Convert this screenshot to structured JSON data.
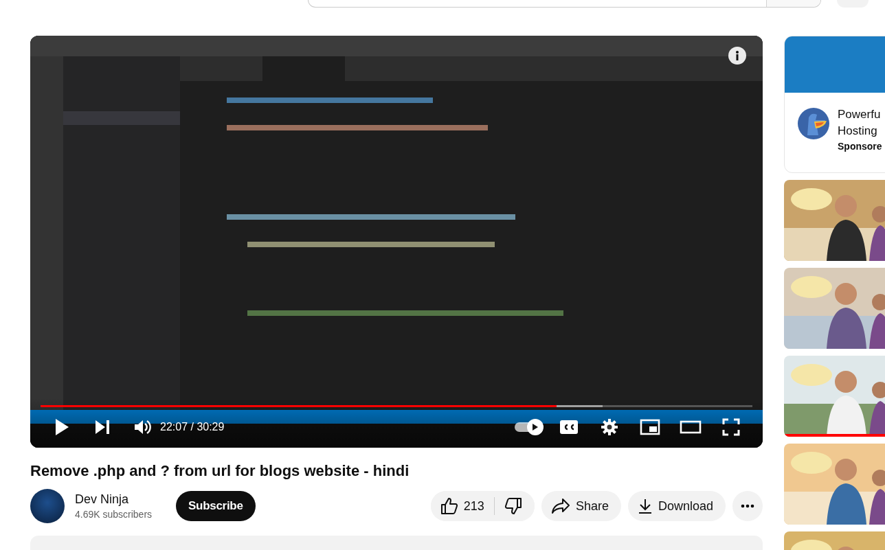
{
  "player": {
    "video": {
      "kind": "picture"
    },
    "progress": {
      "level": 0.725
    },
    "time": "22:07 / 30:29",
    "autoplay": {
      "on": true
    }
  },
  "video_title": "Remove .php and ? from url for blogs website - hindi",
  "channel": {
    "name": "Dev Ninja",
    "subscribers": "4.69K subscribers",
    "subscribe": "Subscribe"
  },
  "actions": {
    "likes": "213",
    "share": "Share",
    "download": "Download"
  },
  "sidebar": {
    "ad": {
      "title_lines": [
        "Powerfu",
        "Hosting"
      ],
      "label": "Sponsore"
    },
    "thumbnails": [
      {
        "kind": "picture"
      },
      {
        "kind": "picture"
      },
      {
        "kind": "picture",
        "watched": {
          "level": 1
        }
      },
      {
        "kind": "picture"
      },
      {
        "kind": "picture"
      }
    ]
  }
}
